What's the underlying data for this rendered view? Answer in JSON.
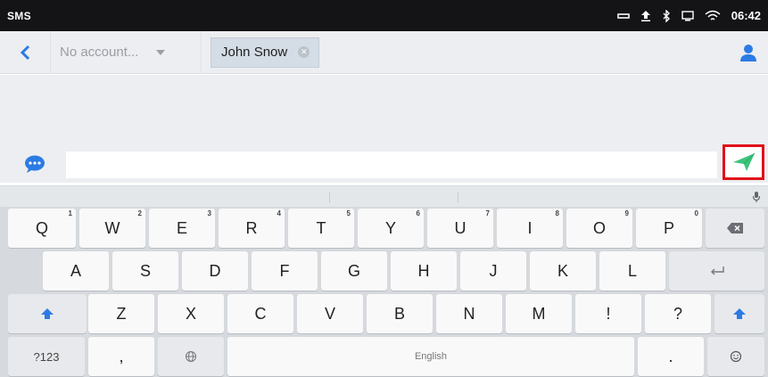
{
  "status_bar": {
    "app_name": "SMS",
    "time": "06:42",
    "icons": [
      "notification-icon",
      "upload-icon",
      "bluetooth-icon",
      "screen-icon",
      "wifi-icon"
    ]
  },
  "header": {
    "account_placeholder": "No account...",
    "recipient": "John Snow"
  },
  "compose": {
    "placeholder": ""
  },
  "keyboard": {
    "row1": [
      {
        "label": "Q",
        "num": "1"
      },
      {
        "label": "W",
        "num": "2"
      },
      {
        "label": "E",
        "num": "3"
      },
      {
        "label": "R",
        "num": "4"
      },
      {
        "label": "T",
        "num": "5"
      },
      {
        "label": "Y",
        "num": "6"
      },
      {
        "label": "U",
        "num": "7"
      },
      {
        "label": "I",
        "num": "8"
      },
      {
        "label": "O",
        "num": "9"
      },
      {
        "label": "P",
        "num": "0"
      }
    ],
    "row2": [
      "A",
      "S",
      "D",
      "F",
      "G",
      "H",
      "J",
      "K",
      "L"
    ],
    "row3": [
      "Z",
      "X",
      "C",
      "V",
      "B",
      "N",
      "M",
      "!",
      "?"
    ],
    "symbols_label": "?123",
    "comma_label": ",",
    "space_label": "English",
    "period_label": "."
  },
  "colors": {
    "accent": "#2c7be5",
    "send_icon": "#3cc47c",
    "highlight": "#e0101a"
  }
}
